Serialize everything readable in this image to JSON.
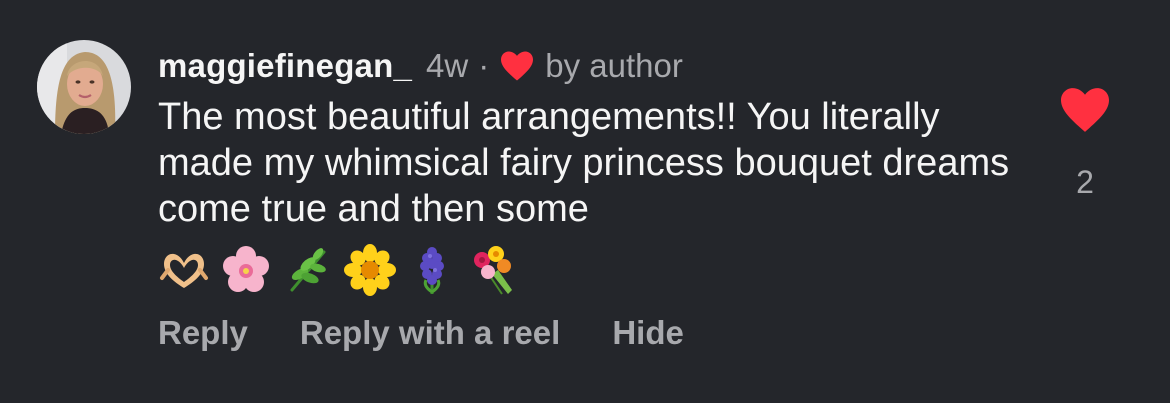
{
  "comment": {
    "username": "maggiefinegan_",
    "time": "4w",
    "separator": "·",
    "liked_by_author_label": "by author",
    "text": "The most beautiful arrangements!! You literally made my whimsical fairy princess bouquet dreams come true and then some",
    "emojis": [
      "heart-hands-emoji",
      "cherry-blossom-emoji",
      "herb-emoji",
      "sunflower-emoji",
      "hyacinth-emoji",
      "bouquet-emoji"
    ],
    "like_count": "2",
    "like_color": "#ff3040",
    "actions": {
      "reply": "Reply",
      "reply_with_reel": "Reply with a reel",
      "hide": "Hide"
    }
  }
}
